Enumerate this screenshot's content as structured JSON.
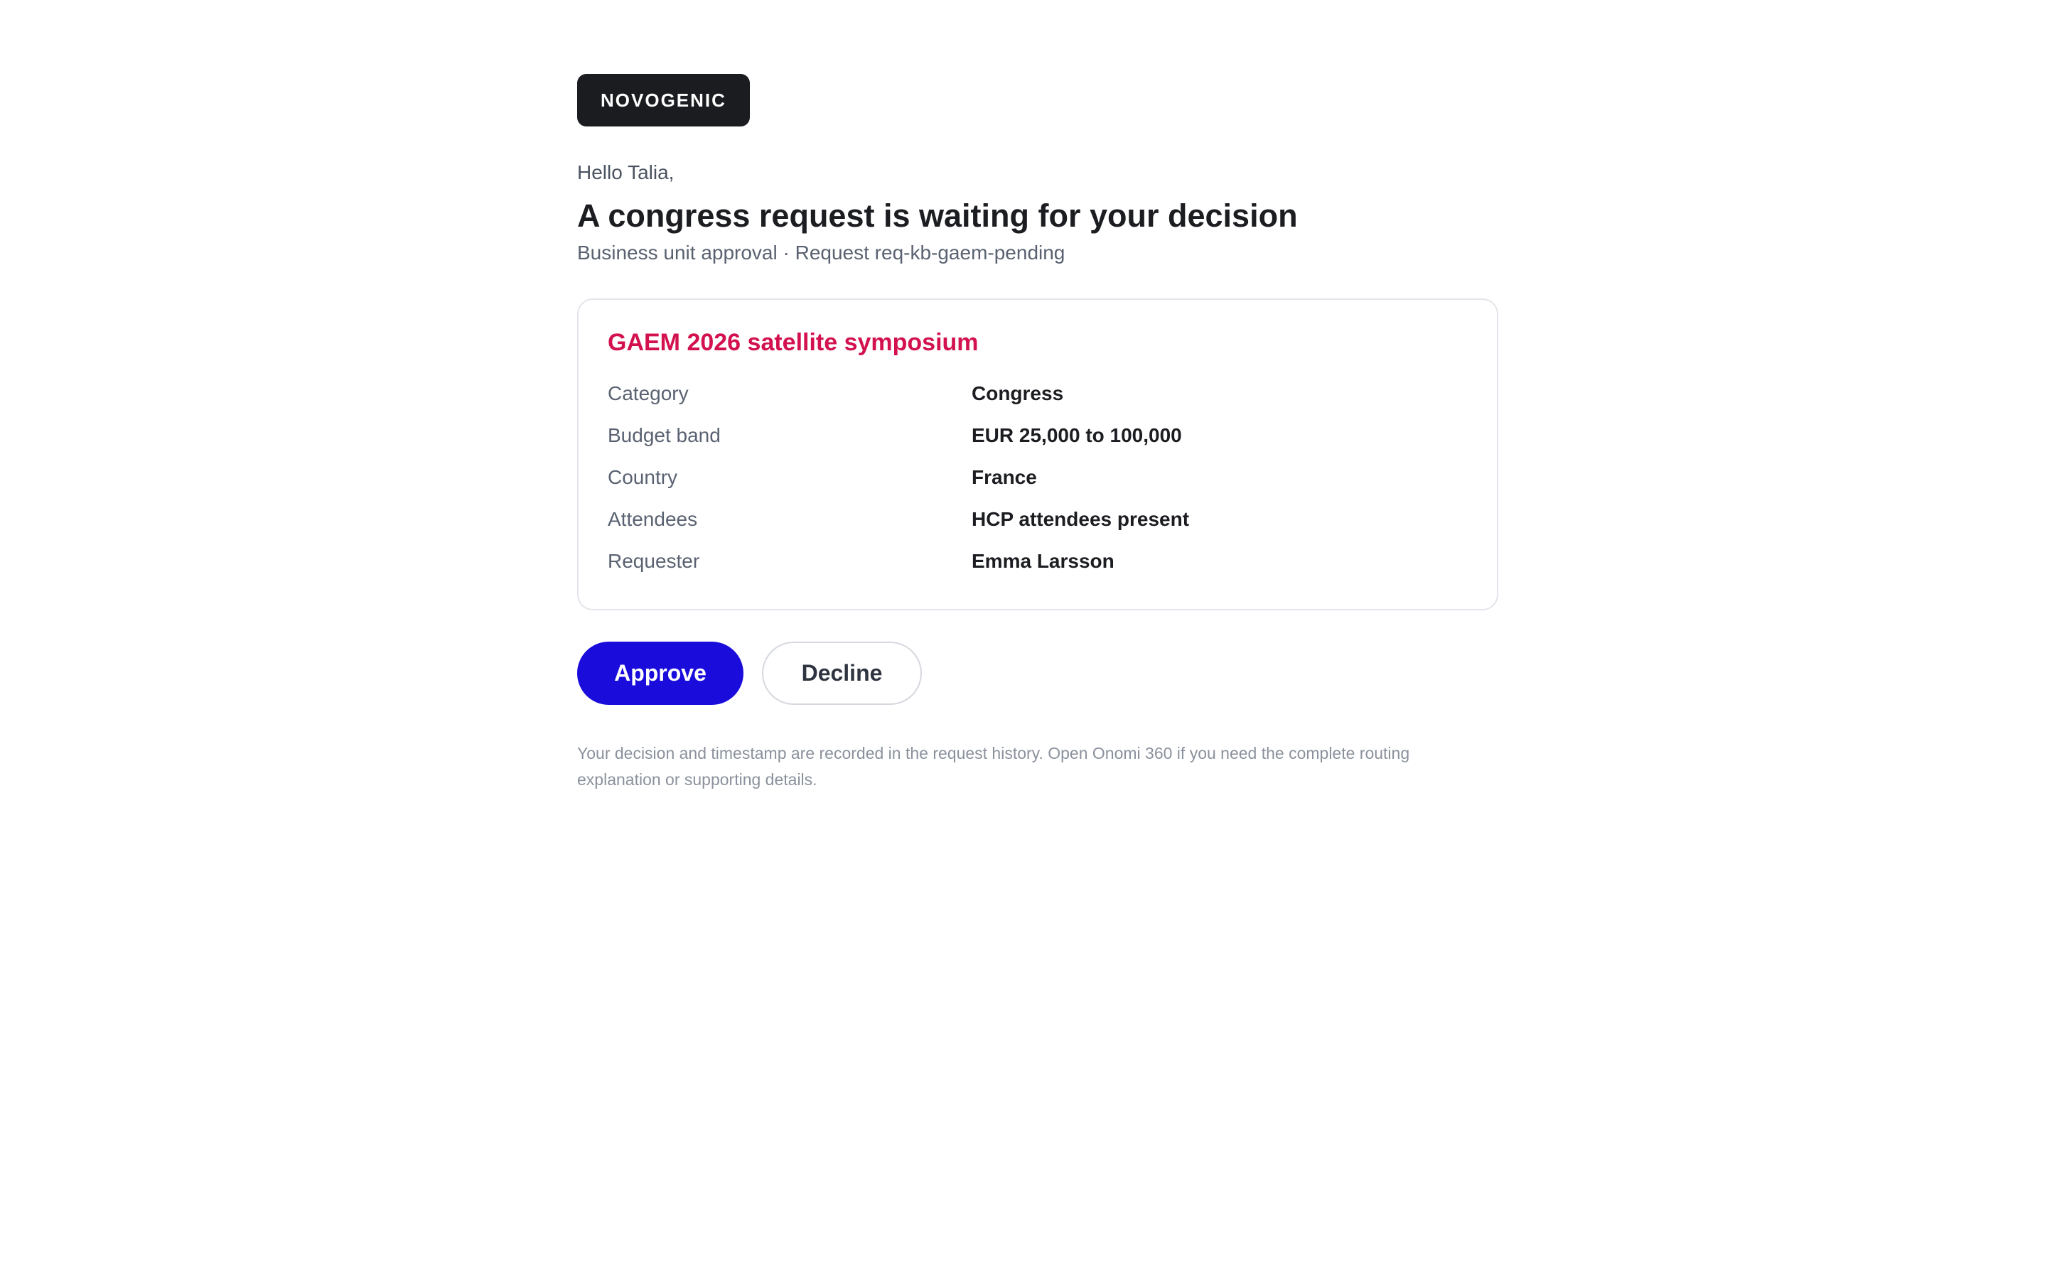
{
  "brand": {
    "name": "NOVOGENIC"
  },
  "greeting": "Hello Talia,",
  "headline": "A congress request is waiting for your decision",
  "subline": "Business unit approval · Request req-kb-gaem-pending",
  "card": {
    "title": "GAEM 2026 satellite symposium",
    "details": [
      {
        "label": "Category",
        "value": "Congress"
      },
      {
        "label": "Budget band",
        "value": "EUR 25,000 to 100,000"
      },
      {
        "label": "Country",
        "value": "France"
      },
      {
        "label": "Attendees",
        "value": "HCP attendees present"
      },
      {
        "label": "Requester",
        "value": "Emma Larsson"
      }
    ]
  },
  "actions": {
    "approve_label": "Approve",
    "decline_label": "Decline"
  },
  "footnote": "Your decision and timestamp are recorded in the request history. Open Onomi 360 if you need the complete routing explanation or supporting details.",
  "colors": {
    "brand_badge": "#1b1c1f",
    "card_title": "#d2114e",
    "approve_button": "#1a0ddb"
  }
}
